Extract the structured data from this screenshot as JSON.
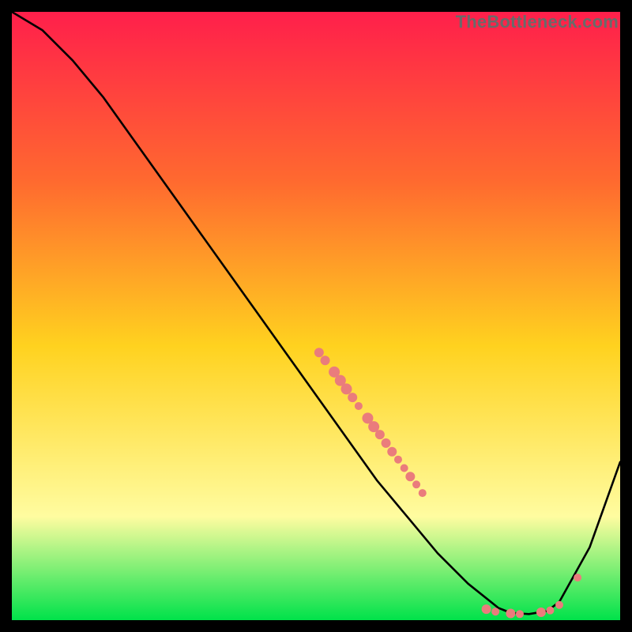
{
  "watermark": "TheBottleneck.com",
  "colors": {
    "gradient_top": "#ff1f4b",
    "gradient_mid_upper": "#ff6a2f",
    "gradient_mid": "#ffd21f",
    "gradient_mid_lower": "#fffca0",
    "gradient_bottom": "#00e24a",
    "line": "#000000",
    "marker": "#ea7c7c",
    "background": "#000000"
  },
  "chart_data": {
    "type": "line",
    "title": "",
    "xlabel": "",
    "ylabel": "",
    "xlim": [
      0,
      100
    ],
    "ylim": [
      0,
      100
    ],
    "series": [
      {
        "name": "curve",
        "x": [
          0,
          5,
          10,
          15,
          20,
          25,
          30,
          35,
          40,
          45,
          50,
          55,
          60,
          65,
          70,
          75,
          80,
          82,
          85,
          88,
          90,
          95,
          100
        ],
        "y": [
          100,
          97,
          92,
          86,
          79,
          72,
          65,
          58,
          51,
          44,
          37,
          30,
          23,
          17,
          11,
          6,
          2,
          1.2,
          1,
          1.5,
          3,
          12,
          26
        ]
      }
    ],
    "markers": {
      "name": "points",
      "points": [
        {
          "x": 50.5,
          "y": 44.0,
          "r": 6
        },
        {
          "x": 51.5,
          "y": 42.7,
          "r": 6
        },
        {
          "x": 53.0,
          "y": 40.8,
          "r": 7
        },
        {
          "x": 54.0,
          "y": 39.4,
          "r": 7
        },
        {
          "x": 55.0,
          "y": 38.0,
          "r": 7
        },
        {
          "x": 56.0,
          "y": 36.6,
          "r": 6
        },
        {
          "x": 57.0,
          "y": 35.2,
          "r": 5
        },
        {
          "x": 58.5,
          "y": 33.2,
          "r": 7
        },
        {
          "x": 59.5,
          "y": 31.8,
          "r": 7
        },
        {
          "x": 60.5,
          "y": 30.5,
          "r": 6
        },
        {
          "x": 61.5,
          "y": 29.1,
          "r": 6
        },
        {
          "x": 62.5,
          "y": 27.7,
          "r": 6
        },
        {
          "x": 63.5,
          "y": 26.4,
          "r": 5
        },
        {
          "x": 64.5,
          "y": 25.0,
          "r": 5
        },
        {
          "x": 65.5,
          "y": 23.6,
          "r": 6
        },
        {
          "x": 66.5,
          "y": 22.3,
          "r": 5
        },
        {
          "x": 67.5,
          "y": 20.9,
          "r": 5
        },
        {
          "x": 78.0,
          "y": 1.8,
          "r": 6
        },
        {
          "x": 79.5,
          "y": 1.4,
          "r": 5
        },
        {
          "x": 82.0,
          "y": 1.1,
          "r": 6
        },
        {
          "x": 83.5,
          "y": 1.0,
          "r": 5
        },
        {
          "x": 87.0,
          "y": 1.3,
          "r": 6
        },
        {
          "x": 88.5,
          "y": 1.6,
          "r": 5
        },
        {
          "x": 90.0,
          "y": 2.5,
          "r": 5
        },
        {
          "x": 93.0,
          "y": 7.0,
          "r": 5
        }
      ]
    }
  }
}
